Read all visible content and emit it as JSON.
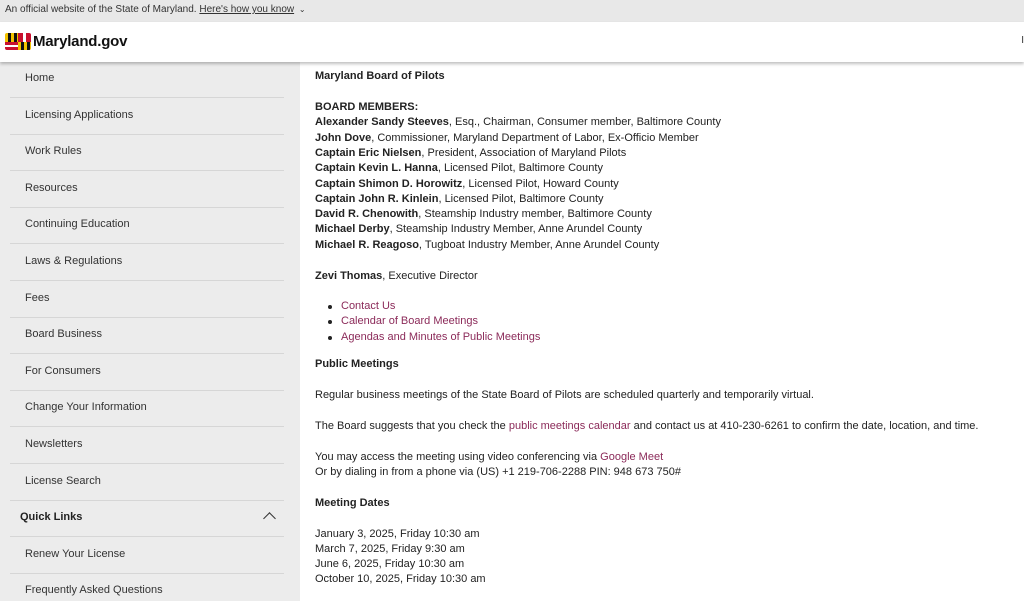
{
  "official_bar": {
    "text": "An official website of the State of Maryland.",
    "link": "Here's how you know",
    "caret": "⌄"
  },
  "header": {
    "logo_text": "Maryland.gov",
    "edge_glyph": "I"
  },
  "sidebar": {
    "items": [
      {
        "label": "Home"
      },
      {
        "label": "Licensing Applications"
      },
      {
        "label": "Work Rules"
      },
      {
        "label": "Resources"
      },
      {
        "label": "Continuing Education"
      },
      {
        "label": "Laws & Regulations"
      },
      {
        "label": "Fees"
      },
      {
        "label": "Board Business"
      },
      {
        "label": "For Consumers"
      },
      {
        "label": "Change Your Information"
      },
      {
        "label": "Newsletters"
      },
      {
        "label": "License Search"
      }
    ],
    "quick_links": {
      "title": "Quick Links",
      "items": [
        {
          "label": "Renew Your License"
        },
        {
          "label": "Frequently Asked Questions"
        }
      ]
    }
  },
  "content": {
    "title": "Maryland Board of Pilots",
    "members_heading": "BOARD MEMBERS:",
    "members": [
      {
        "name": "Alexander Sandy Steeves",
        "role": ", Esq., Chairman, Consumer member, Baltimore County"
      },
      {
        "name": "John Dove",
        "role": ", Commissioner, Maryland Department of Labor, Ex-Officio Member"
      },
      {
        "name": "Captain Eric Nielsen",
        "role": ", President, Association of Maryland Pilots"
      },
      {
        "name": "Captain Kevin L. Hanna",
        "role": ", Licensed Pilot, Baltimore County"
      },
      {
        "name": "Captain Shimon D. Horowitz",
        "role": ", Licensed Pilot, Howard County"
      },
      {
        "name": "Captain John R. Kinlein",
        "role": ", Licensed Pilot, Baltimore County"
      },
      {
        "name": "David R. Chenowith",
        "role": ", Steamship Industry member, Baltimore County"
      },
      {
        "name": "Michael Derby",
        "role": ", Steamship Industry Member, Anne Arundel County"
      },
      {
        "name": "Michael R. Reagoso",
        "role": ", Tugboat Industry Member, Anne Arundel County"
      }
    ],
    "executive": {
      "name": "Zevi Thomas",
      "role": ", Executive Director"
    },
    "links": [
      {
        "label": "Contact Us"
      },
      {
        "label": "Calendar of Board Meetings"
      },
      {
        "label": "Agendas and Minutes of Public Meetings"
      }
    ],
    "public_meetings": {
      "heading": "Public Meetings",
      "regular": "Regular business meetings of the State Board of Pilots are scheduled quarterly and temporarily virtual.",
      "suggest_before": "The Board suggests that you check the ",
      "suggest_link": "public meetings calendar",
      "suggest_after": " and contact us at 410-230-6261 to confirm the date, location, and time.",
      "access_before": "You may access the meeting using video conferencing via ",
      "access_link": "Google Meet",
      "dial": "Or by dialing in from a phone via (US) +1 219-706-2288 PIN: 948 673 750#"
    },
    "meeting_dates": {
      "heading": "Meeting Dates",
      "dates": [
        "January 3, 2025, Friday 10:30 am",
        "March 7, 2025, Friday 9:30 am",
        "June 6, 2025, Friday 10:30 am",
        "October 10, 2025, Friday 10:30 am"
      ]
    }
  }
}
